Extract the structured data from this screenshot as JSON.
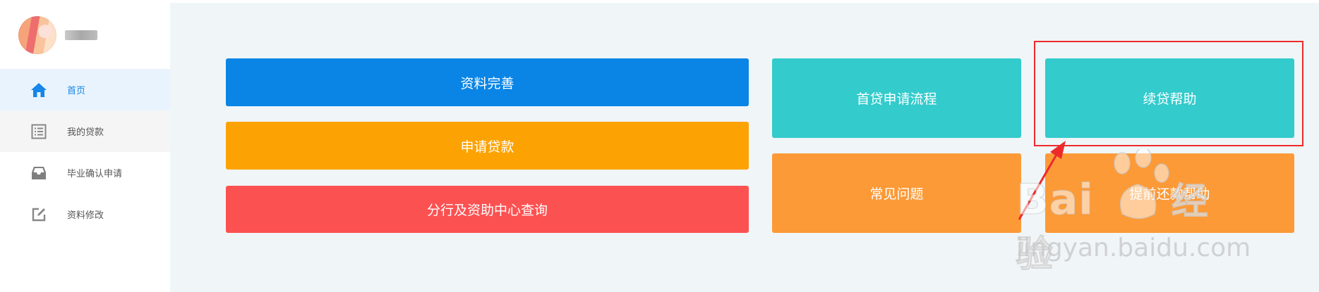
{
  "user": {
    "name_redacted": ""
  },
  "menu": [
    {
      "label": "首页",
      "icon": "home-icon",
      "state": "active"
    },
    {
      "label": "我的贷款",
      "icon": "list-icon",
      "state": "hover"
    },
    {
      "label": "毕业确认申请",
      "icon": "inbox-icon",
      "state": "normal"
    },
    {
      "label": "资料修改",
      "icon": "edit-icon",
      "state": "normal"
    }
  ],
  "buttons": {
    "profile": "资料完善",
    "apply_loan": "申请贷款",
    "branch_query": "分行及资助中心查询",
    "first_loan_process": "首贷申请流程",
    "renew_help": "续贷帮助",
    "faq": "常见问题",
    "repay_help": "提前还款帮助"
  },
  "watermark": {
    "brand": "Bai",
    "brand_cn": "经验",
    "url": "jingyan.baidu.com"
  },
  "colors": {
    "blue": "#0a85e6",
    "yellow": "#fca303",
    "red": "#fc5151",
    "teal": "#33cbcc",
    "orange": "#fc9a37",
    "highlight": "#ee2b2b"
  }
}
